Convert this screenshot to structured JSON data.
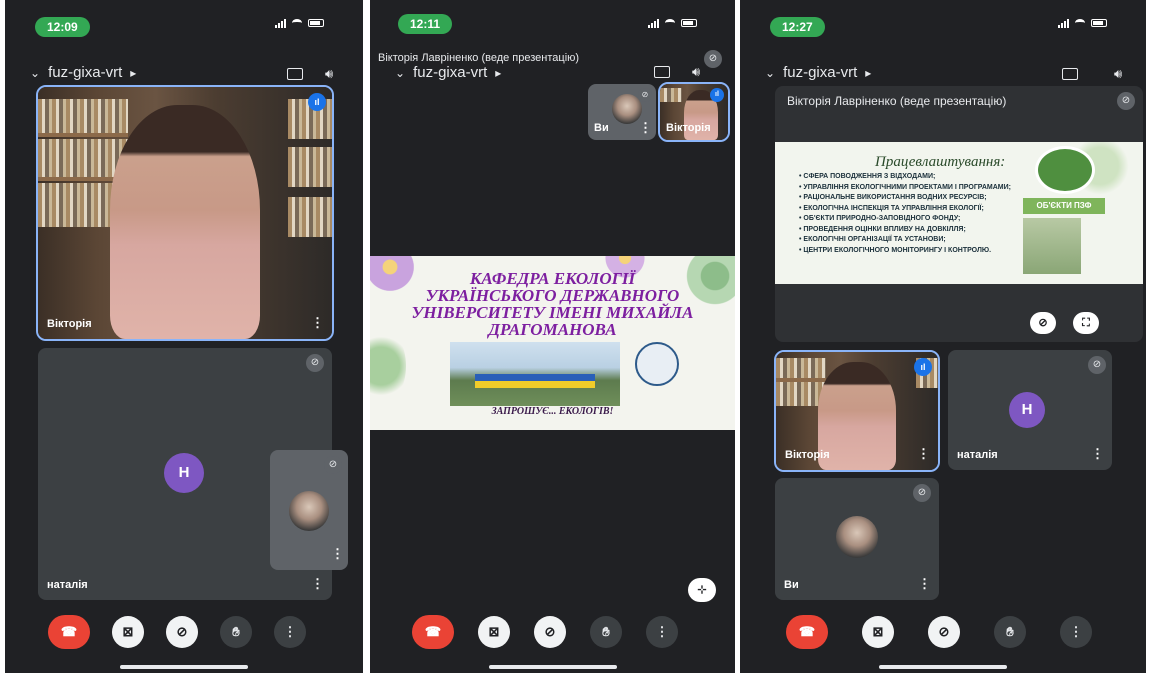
{
  "screens": [
    {
      "time": "12:09",
      "meeting_code": "fuz-gixa-vrt",
      "tiles": [
        {
          "name": "Вікторія"
        },
        {
          "name": "наталія",
          "avatar_letter": "Н"
        }
      ]
    },
    {
      "time": "12:11",
      "presenter_label": "Вікторія Лавріненко (веде презентацію)",
      "meeting_code": "fuz-gixa-vrt",
      "mini_tiles": [
        {
          "name": "Ви"
        },
        {
          "name": "Вікторія"
        }
      ],
      "slide": {
        "title_lines": [
          "КАФЕДРА ЕКОЛОГІЇ",
          "УКРАЇНСЬКОГО ДЕРЖАВНОГО",
          "УНІВЕРСИТЕТУ ІМЕНІ МИХАЙЛА",
          "ДРАГОМАНОВА"
        ],
        "footer": "ЗАПРОШУЄ... ЕКОЛОГІВ!"
      }
    },
    {
      "time": "12:27",
      "meeting_code": "fuz-gixa-vrt",
      "presenter_label": "Вікторія Лавріненко (веде презентацію)",
      "slide": {
        "title": "Працевлаштування:",
        "items": [
          "• СФЕРА ПОВОДЖЕННЯ З ВІДХОДАМИ;",
          "• УПРАВЛІННЯ ЕКОЛОГІЧНИМИ ПРОЕКТАМИ І ПРОГРАМАМИ;",
          "• РАЦІОНАЛЬНЕ ВИКОРИСТАННЯ ВОДНИХ РЕСУРСІВ;",
          "• ЕКОЛОГІЧНА ІНСПЕКЦІЯ ТА УПРАВЛІННЯ ЕКОЛОГІЇ;",
          "• ОБ'ЄКТИ ПРИРОДНО-ЗАПОВІДНОГО ФОНДУ;",
          "• ПРОВЕДЕННЯ ОЦІНКИ ВПЛИВУ НА ДОВКІЛЛЯ;",
          "• ЕКОЛОГІЧНІ ОРГАНІЗАЦІЇ ТА УСТАНОВИ;",
          "• ЦЕНТРИ ЕКОЛОГІЧНОГО МОНІТОРИНГУ І КОНТРОЛЮ."
        ],
        "badge": "ОБ'ЄКТИ ПЗФ"
      },
      "tiles": [
        {
          "name": "Вікторія"
        },
        {
          "name": "наталія",
          "avatar_letter": "Н"
        },
        {
          "name": "Ви"
        }
      ]
    }
  ]
}
